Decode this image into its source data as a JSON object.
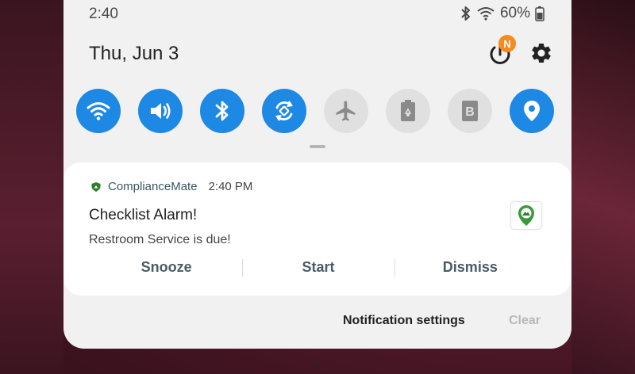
{
  "status_bar": {
    "time": "2:40",
    "battery_percent": "60%",
    "icons": [
      "bluetooth-icon",
      "wifi-icon",
      "battery-icon"
    ]
  },
  "header": {
    "date": "Thu, Jun 3",
    "badge_letter": "N",
    "icons": [
      "power-icon",
      "gear-icon"
    ]
  },
  "quick_settings": [
    {
      "icon": "wifi-icon",
      "state": "on"
    },
    {
      "icon": "volume-icon",
      "state": "on"
    },
    {
      "icon": "bluetooth-icon",
      "state": "on"
    },
    {
      "icon": "auto-rotate-icon",
      "state": "on"
    },
    {
      "icon": "airplane-icon",
      "state": "off"
    },
    {
      "icon": "power-saving-icon",
      "state": "off"
    },
    {
      "icon": "blue-light-filter-icon",
      "state": "off"
    },
    {
      "icon": "location-icon",
      "state": "on"
    }
  ],
  "notification": {
    "app_name": "ComplianceMate",
    "time": "2:40 PM",
    "title": "Checklist Alarm!",
    "body": "Restroom Service is due!",
    "actions": [
      "Snooze",
      "Start",
      "Dismiss"
    ]
  },
  "footer": {
    "settings_label": "Notification settings",
    "clear_label": "Clear"
  },
  "colors": {
    "accent_on": "#1e88e5",
    "toggle_off": "#e0e0e0",
    "badge": "#f58a1f",
    "app_green": "#3a9a3a"
  }
}
